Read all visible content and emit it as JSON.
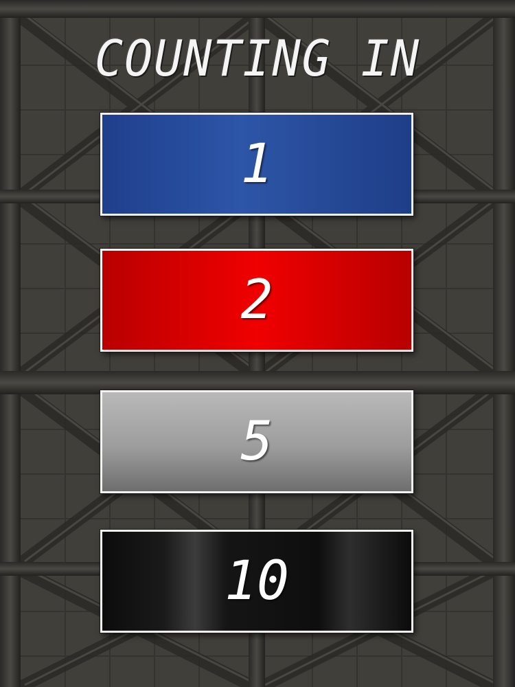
{
  "screen": {
    "title": "COUNTING IN"
  },
  "options": [
    {
      "label": "1",
      "color": "#2a4f9e"
    },
    {
      "label": "2",
      "color": "#e00000"
    },
    {
      "label": "5",
      "color": "#a8a8a8"
    },
    {
      "label": "10",
      "color": "#111111"
    }
  ],
  "background": {
    "style": "metal-crate-panels",
    "color": "#3b3a36"
  }
}
